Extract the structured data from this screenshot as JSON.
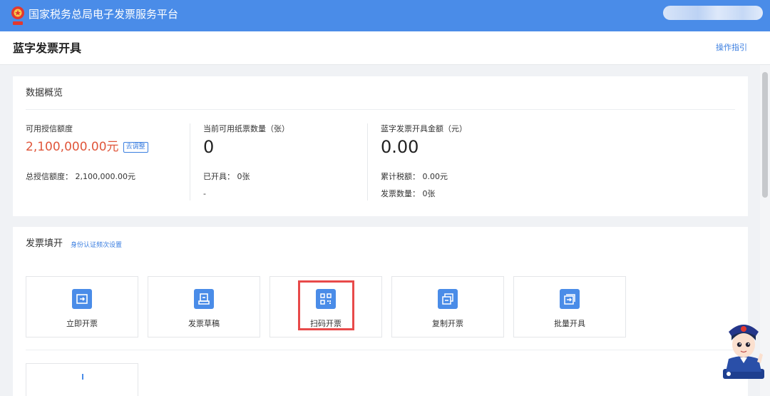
{
  "topbar": {
    "title": "国家税务总局电子发票服务平台",
    "emblem_icon": "tax-emblem-icon"
  },
  "page": {
    "title": "蓝字发票开具",
    "guide_link": "操作指引"
  },
  "overview": {
    "title": "数据概览",
    "credit": {
      "label": "可用授信额度",
      "value": "2,100,000.00元",
      "adjust_button": "去调整",
      "total_label": "总授信额度：",
      "total_value": "2,100,000.00元"
    },
    "paper": {
      "label": "当前可用纸票数量（张）",
      "value": "0",
      "issued_label": "已开具：",
      "issued_value": "0张",
      "extra": "-"
    },
    "amount": {
      "label": "蓝字发票开具金额（元）",
      "value": "0.00",
      "tax_label": "累计税额：",
      "tax_value": "0.00元",
      "count_label": "发票数量：",
      "count_value": "0张"
    }
  },
  "fill": {
    "title": "发票填开",
    "id_link": "身份认证频次设置",
    "tiles": [
      {
        "label": "立即开票",
        "icon": "issue-now-icon"
      },
      {
        "label": "发票草稿",
        "icon": "draft-icon"
      },
      {
        "label": "扫码开票",
        "icon": "qr-code-icon"
      },
      {
        "label": "复制开票",
        "icon": "copy-invoice-icon"
      },
      {
        "label": "批量开具",
        "icon": "batch-issue-icon"
      }
    ]
  },
  "colors": {
    "topbar": "#4a8ce8",
    "accent_link": "#3a7ee0",
    "credit_value": "#e0563b",
    "highlight": "#e84a4a"
  }
}
